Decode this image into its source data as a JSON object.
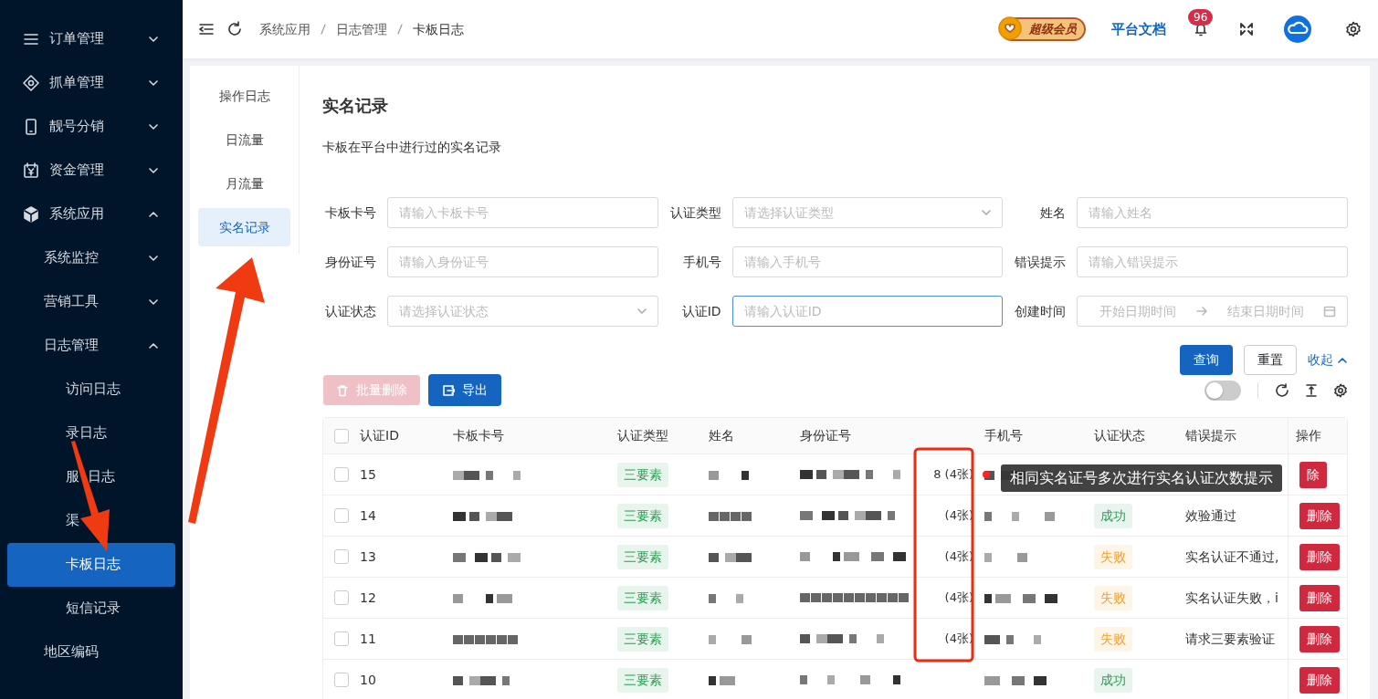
{
  "sidebar": {
    "items": [
      {
        "label": "订单管理",
        "expanded": false
      },
      {
        "label": "抓单管理",
        "expanded": false
      },
      {
        "label": "靓号分销",
        "expanded": false
      },
      {
        "label": "资金管理",
        "expanded": false
      },
      {
        "label": "系统应用",
        "expanded": true,
        "children": [
          {
            "label": "系统监控",
            "expanded": false
          },
          {
            "label": "营销工具",
            "expanded": false
          },
          {
            "label": "日志管理",
            "expanded": true,
            "children": [
              {
                "label": "访问日志",
                "selected": false
              },
              {
                "label": "录日志",
                "selected": false
              },
              {
                "label": "服  日志",
                "selected": false
              },
              {
                "label": "渠",
                "selected": false
              },
              {
                "label": "卡板日志",
                "selected": true
              },
              {
                "label": "短信记录",
                "selected": false
              }
            ]
          },
          {
            "label": "地区编码"
          }
        ]
      }
    ]
  },
  "header": {
    "breadcrumb": [
      "系统应用",
      "日志管理",
      "卡板日志"
    ],
    "vip_badge": "超级会员",
    "docs_link": "平台文档",
    "notification_count": "96"
  },
  "tabs": [
    {
      "label": "操作日志",
      "selected": false
    },
    {
      "label": "日流量",
      "selected": false
    },
    {
      "label": "月流量",
      "selected": false
    },
    {
      "label": "实名记录",
      "selected": true
    }
  ],
  "page": {
    "title": "实名记录",
    "description": "卡板在平台中进行过的实名记录"
  },
  "filters": [
    {
      "label": "卡板卡号",
      "kind": "text",
      "placeholder": "请输入卡板卡号",
      "focused": false
    },
    {
      "label": "认证类型",
      "kind": "select",
      "placeholder": "请选择认证类型",
      "focused": false
    },
    {
      "label": "姓名",
      "kind": "text",
      "placeholder": "请输入姓名",
      "focused": false
    },
    {
      "label": "身份证号",
      "kind": "text",
      "placeholder": "请输入身份证号",
      "focused": false
    },
    {
      "label": "手机号",
      "kind": "text",
      "placeholder": "请输入手机号",
      "focused": false
    },
    {
      "label": "错误提示",
      "kind": "text",
      "placeholder": "请输入错误提示",
      "focused": false
    },
    {
      "label": "认证状态",
      "kind": "select",
      "placeholder": "请选择认证状态",
      "focused": false
    },
    {
      "label": "认证ID",
      "kind": "text",
      "placeholder": "请输入认证ID",
      "focused": true
    },
    {
      "label": "创建时间",
      "kind": "daterange",
      "placeholder": "开始日期时间",
      "placeholder_end": "结束日期时间",
      "focused": false
    }
  ],
  "filter_actions": {
    "search": "查询",
    "reset": "重置",
    "collapse": "收起"
  },
  "toolbar": {
    "batch_delete": {
      "label": "批量删除",
      "disabled": true
    },
    "export": {
      "label": "导出"
    },
    "switch_on": false
  },
  "table": {
    "select_all_checked": false,
    "columns": [
      "认证ID",
      "卡板卡号",
      "认证类型",
      "姓名",
      "身份证号",
      "手机号",
      "认证状态",
      "错误提示",
      "操作"
    ],
    "rows": [
      {
        "id": "15",
        "type": "三要素",
        "id_count": "8 (4张)",
        "action": "除",
        "checked": false
      },
      {
        "id": "14",
        "type": "三要素",
        "id_count": "(4张)",
        "status": "成功",
        "color": "#2e9e57",
        "error": "效验通过",
        "action": "删除",
        "checked": false
      },
      {
        "id": "13",
        "type": "三要素",
        "id_count": "(4张)",
        "status": "失败",
        "color": "#f0a030",
        "error": "实名认证不通过,",
        "action": "删除",
        "checked": false
      },
      {
        "id": "12",
        "type": "三要素",
        "id_count": "(4张)",
        "status": "失败",
        "color": "#f0a030",
        "error": "实名认证失败，i",
        "action": "删除",
        "checked": false
      },
      {
        "id": "11",
        "type": "三要素",
        "id_count": "(4张)",
        "status": "失败",
        "color": "#f0a030",
        "error": "请求三要素验证",
        "action": "删除",
        "checked": false
      },
      {
        "id": "10",
        "type": "三要素",
        "status": "成功",
        "color": "#2e9e57",
        "action": "删除",
        "checked": false
      }
    ]
  },
  "tooltip": {
    "text": "相同实名证号多次进行实名认证次数提示"
  }
}
